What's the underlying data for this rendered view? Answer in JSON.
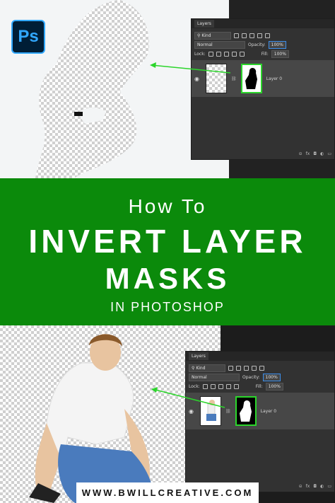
{
  "colors": {
    "banner_green": "#0b8a0b",
    "mask_highlight": "#2bd52b",
    "ps_blue": "#31a8ff",
    "ps_dark": "#001e36"
  },
  "logo": {
    "text": "Ps",
    "icon": "photoshop-logo"
  },
  "top_panel": {
    "tab": "Layers",
    "filter": "Kind",
    "blend_mode": "Normal",
    "opacity_label": "Opacity:",
    "opacity_value": "100%",
    "lock_label": "Lock:",
    "fill_label": "Fill:",
    "fill_value": "100%",
    "layer_name": "Layer 0",
    "footer_icons": [
      "link-icon",
      "fx-icon",
      "mask-icon",
      "adjustment-icon",
      "folder-icon"
    ]
  },
  "banner": {
    "line1": "How To",
    "line2": "INVERT LAYER",
    "line3": "MASKS",
    "line4": "IN PHOTOSHOP"
  },
  "bottom_panel": {
    "tab": "Layers",
    "filter": "Kind",
    "blend_mode": "Normal",
    "opacity_label": "Opacity:",
    "opacity_value": "100%",
    "lock_label": "Lock:",
    "fill_label": "Fill:",
    "fill_value": "100%",
    "layer_name": "Layer 0",
    "footer_icons": [
      "link-icon",
      "fx-icon",
      "mask-icon",
      "adjustment-icon",
      "folder-icon"
    ]
  },
  "footer": {
    "url": "WWW.BWILLCREATIVE.COM"
  }
}
